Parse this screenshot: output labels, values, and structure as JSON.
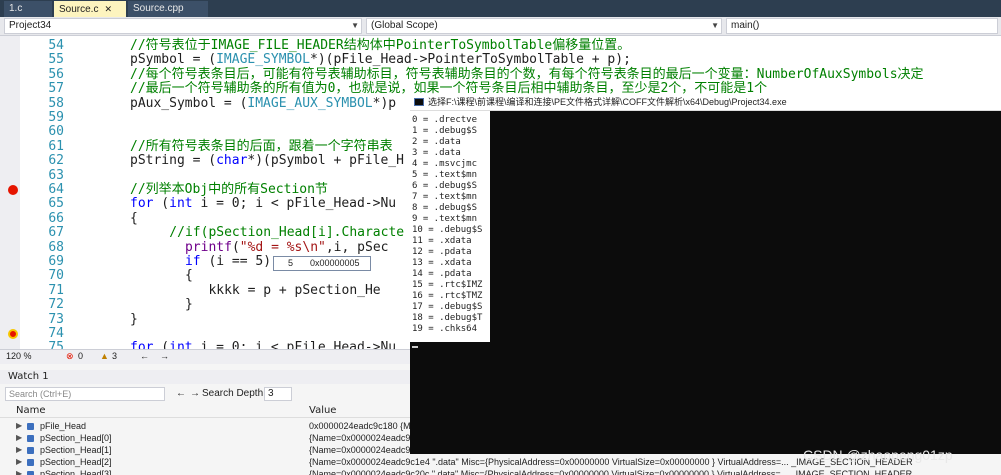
{
  "tabs": [
    {
      "label": "1.c",
      "active": false
    },
    {
      "label": "Source.c",
      "active": true
    },
    {
      "label": "Source.cpp",
      "active": false
    }
  ],
  "nav": {
    "project": "Project34",
    "scope": "(Global Scope)",
    "function": "main()"
  },
  "code_lines": [
    {
      "num": "54",
      "html_tokens": [
        [
          "cm",
          "//符号表位于IMAGE_FILE_HEADER结构体中PointerToSymbolTable偏移量位置。"
        ]
      ]
    },
    {
      "num": "55",
      "html_tokens": [
        [
          "",
          "pSymbol = ("
        ],
        [
          "ty",
          "IMAGE_SYMBOL"
        ],
        [
          "",
          "*)(pFile_Head->PointerToSymbolTable + p);"
        ]
      ]
    },
    {
      "num": "56",
      "html_tokens": [
        [
          "cm",
          "//每个符号表条目后，可能有符号表辅助标目，符号表辅助条目的个数，有每个符号表条目的最后一个变量：NumberOfAuxSymbols决定"
        ]
      ]
    },
    {
      "num": "57",
      "html_tokens": [
        [
          "cm",
          "//最后一个符号辅助条的所有值为0，也就是说，如果一个符号条目后相中辅助条目，至少是2个，不可能是1个"
        ]
      ]
    },
    {
      "num": "58",
      "html_tokens": [
        [
          "",
          "pAux_Symbol = ("
        ],
        [
          "ty",
          "IMAGE_AUX_SYMBOL"
        ],
        [
          "",
          "*)p"
        ]
      ]
    },
    {
      "num": "59",
      "html_tokens": [
        [
          "",
          ""
        ]
      ]
    },
    {
      "num": "60",
      "html_tokens": [
        [
          "",
          ""
        ]
      ]
    },
    {
      "num": "61",
      "html_tokens": [
        [
          "cm",
          "//所有符号表条目的后面，跟着一个字符串表"
        ]
      ]
    },
    {
      "num": "62",
      "html_tokens": [
        [
          "",
          "pString = ("
        ],
        [
          "kw",
          "char"
        ],
        [
          "",
          "*)(pSymbol + pFile_H"
        ]
      ]
    },
    {
      "num": "63",
      "html_tokens": [
        [
          "",
          ""
        ]
      ]
    },
    {
      "num": "64",
      "html_tokens": [
        [
          "cm",
          "//列举本Obj中的所有Section节"
        ]
      ]
    },
    {
      "num": "65",
      "html_tokens": [
        [
          "kw",
          "for"
        ],
        [
          "",
          " ("
        ],
        [
          "kw",
          "int"
        ],
        [
          "",
          " i = 0; i < pFile_Head->Nu"
        ]
      ]
    },
    {
      "num": "66",
      "html_tokens": [
        [
          "",
          "{"
        ]
      ]
    },
    {
      "num": "67",
      "html_tokens": [
        [
          "cm",
          "    //if(pSection_Head[i].Characte"
        ]
      ]
    },
    {
      "num": "68",
      "html_tokens": [
        [
          "",
          "      "
        ],
        [
          "mc",
          "printf"
        ],
        [
          "",
          "("
        ],
        [
          "st",
          "\"%d = %s\\n\""
        ],
        [
          "",
          ",i, pSec"
        ]
      ]
    },
    {
      "num": "69",
      "html_tokens": [
        [
          "",
          "      "
        ],
        [
          "kw",
          "if"
        ],
        [
          "",
          " (i == 5)"
        ]
      ]
    },
    {
      "num": "70",
      "html_tokens": [
        [
          "",
          "      {"
        ]
      ]
    },
    {
      "num": "71",
      "html_tokens": [
        [
          "",
          "         kkkk = p + pSection_He"
        ]
      ]
    },
    {
      "num": "72",
      "html_tokens": [
        [
          "",
          "      }"
        ]
      ]
    },
    {
      "num": "73",
      "html_tokens": [
        [
          "",
          "}"
        ]
      ]
    },
    {
      "num": "74",
      "html_tokens": [
        [
          "",
          ""
        ]
      ]
    },
    {
      "num": "75",
      "html_tokens": [
        [
          "kw",
          "for"
        ],
        [
          "",
          " ("
        ],
        [
          "kw",
          "int"
        ],
        [
          "",
          " i = 0; i < pFile_Head->Nu"
        ]
      ]
    },
    {
      "num": "76",
      "html_tokens": [
        [
          "",
          "{"
        ]
      ]
    }
  ],
  "datatip": {
    "name": "5",
    "value": "0x00000005"
  },
  "console": {
    "title": "选择F:\\课程\\前课程\\编译和连接\\PE文件格式详解\\COFF文件解析\\x64\\Debug\\Project34.exe",
    "lines": [
      "0 = .drectve",
      "1 = .debug$S",
      "2 = .data",
      "3 = .data",
      "4 = .msvcjmc",
      "5 = .text$mn",
      "6 = .debug$S",
      "7 = .text$mn",
      "8 = .debug$S",
      "9 = .text$mn",
      "10 = .debug$S",
      "11 = .xdata",
      "12 = .pdata",
      "13 = .xdata",
      "14 = .pdata",
      "15 = .rtc$IMZ",
      "16 = .rtc$TMZ",
      "17 = .debug$S",
      "18 = .debug$T",
      "19 = .chks64"
    ]
  },
  "status": {
    "zoom": "120 %",
    "errors": "0",
    "warnings": "3"
  },
  "watch": {
    "title": "Watch 1",
    "search_placeholder": "Search (Ctrl+E)",
    "depth_label": "Search Depth:",
    "depth_value": "3",
    "col_name": "Name",
    "col_value": "Value",
    "rows": [
      {
        "name": "pFile_Head",
        "value": "0x0000024eadc9c180 {Mac"
      },
      {
        "name": "pSection_Head[0]",
        "value": "{Name=0x0000024eadc9c1"
      },
      {
        "name": "pSection_Head[1]",
        "value": "{Name=0x0000024eadc9c1"
      },
      {
        "name": "pSection_Head[2]",
        "value": "{Name=0x0000024eadc9c1e4 \".data\" Misc={PhysicalAddress=0x00000000 VirtualSize=0x00000000 } VirtualAddress=...   _IMAGE_SECTION_HEADER"
      },
      {
        "name": "pSection_Head[3]",
        "value": "{Name=0x0000024eadc9c20c \".data\" Misc={PhysicalAddress=0x00000000 VirtualSize=0x00000000 } VirtualAddress=...   _IMAGE_SECTION_HEADER"
      }
    ]
  },
  "watermark": "CSDN @zhaopeng01zp"
}
